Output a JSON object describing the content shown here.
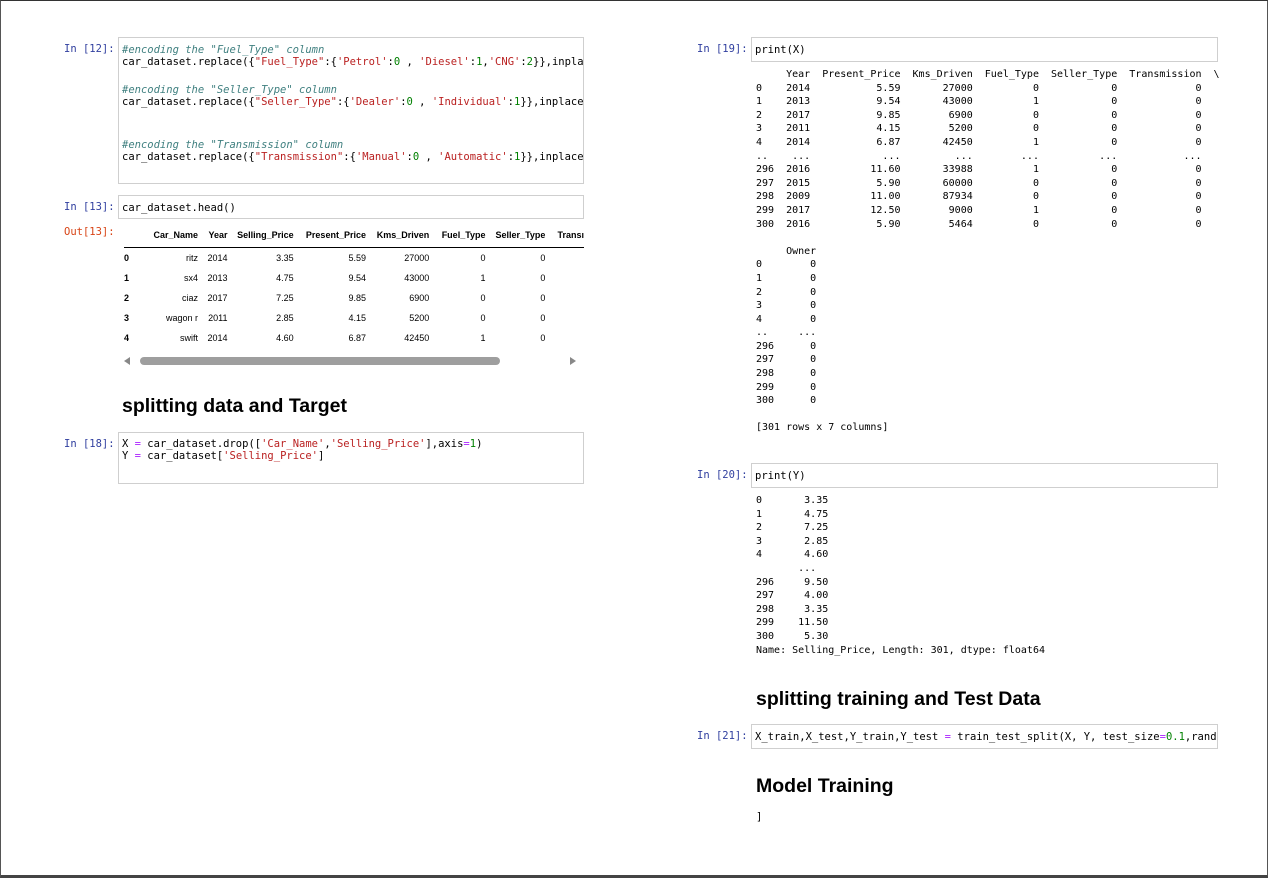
{
  "cells": {
    "c12": {
      "prompt": "In [12]:",
      "comment1": "#encoding the \"Fuel_Type\" column",
      "line1_a": "car_dataset.replace({",
      "line1_s1": "\"Fuel_Type\"",
      "line1_b": ":{",
      "line1_s2": "'Petrol'",
      "line1_c": ":",
      "line1_n1": "0",
      "line1_d": " , ",
      "line1_s3": "'Diesel'",
      "line1_e": ":",
      "line1_n2": "1",
      "line1_f": ",",
      "line1_s4": "'CNG'",
      "line1_g": ":",
      "line1_n3": "2",
      "line1_h": "}},inplace",
      "comment2": "#encoding the \"Seller_Type\" column",
      "line2_a": "car_dataset.replace({",
      "line2_s1": "\"Seller_Type\"",
      "line2_b": ":{",
      "line2_s2": "'Dealer'",
      "line2_c": ":",
      "line2_n1": "0",
      "line2_d": " , ",
      "line2_s3": "'Individual'",
      "line2_e": ":",
      "line2_n2": "1",
      "line2_f": "}},inplace=T",
      "comment3": "#encoding the \"Transmission\" column",
      "line3_a": "car_dataset.replace({",
      "line3_s1": "\"Transmission\"",
      "line3_b": ":{",
      "line3_s2": "'Manual'",
      "line3_c": ":",
      "line3_n1": "0",
      "line3_d": " , ",
      "line3_s3": "'Automatic'",
      "line3_e": ":",
      "line3_n2": "1",
      "line3_f": "}},inplace=T"
    },
    "c13": {
      "prompt": "In [13]:",
      "code": "car_dataset.head()",
      "out_prompt": "Out[13]:",
      "columns": [
        "Car_Name",
        "Year",
        "Selling_Price",
        "Present_Price",
        "Kms_Driven",
        "Fuel_Type",
        "Seller_Type",
        "Transı"
      ],
      "rows": [
        {
          "idx": "0",
          "cells": [
            "ritz",
            "2014",
            "3.35",
            "5.59",
            "27000",
            "0",
            "0"
          ]
        },
        {
          "idx": "1",
          "cells": [
            "sx4",
            "2013",
            "4.75",
            "9.54",
            "43000",
            "1",
            "0"
          ]
        },
        {
          "idx": "2",
          "cells": [
            "ciaz",
            "2017",
            "7.25",
            "9.85",
            "6900",
            "0",
            "0"
          ]
        },
        {
          "idx": "3",
          "cells": [
            "wagon r",
            "2011",
            "2.85",
            "4.15",
            "5200",
            "0",
            "0"
          ]
        },
        {
          "idx": "4",
          "cells": [
            "swift",
            "2014",
            "4.60",
            "6.87",
            "42450",
            "1",
            "0"
          ]
        }
      ]
    },
    "md1": "splitting data and Target",
    "c18": {
      "prompt": "In [18]:",
      "l1_a": "X ",
      "l1_op": "=",
      "l1_b": " car_dataset.drop([",
      "l1_s1": "'Car_Name'",
      "l1_c": ",",
      "l1_s2": "'Selling_Price'",
      "l1_d": "],axis",
      "l1_op2": "=",
      "l1_n": "1",
      "l1_e": ")",
      "l2_a": "Y ",
      "l2_op": "=",
      "l2_b": " car_dataset[",
      "l2_s": "'Selling_Price'",
      "l2_c": "]"
    },
    "c19": {
      "prompt": "In [19]:",
      "code": "print(X)",
      "output": "     Year  Present_Price  Kms_Driven  Fuel_Type  Seller_Type  Transmission  \\\n0    2014           5.59       27000          0            0             0   \n1    2013           9.54       43000          1            0             0   \n2    2017           9.85        6900          0            0             0   \n3    2011           4.15        5200          0            0             0   \n4    2014           6.87       42450          1            0             0   \n..    ...            ...         ...        ...          ...           ...   \n296  2016          11.60       33988          1            0             0   \n297  2015           5.90       60000          0            0             0   \n298  2009          11.00       87934          0            0             0   \n299  2017          12.50        9000          1            0             0   \n300  2016           5.90        5464          0            0             0   \n\n     Owner  \n0        0  \n1        0  \n2        0  \n3        0  \n4        0  \n..     ...  \n296      0  \n297      0  \n298      0  \n299      0  \n300      0  \n\n[301 rows x 7 columns]"
    },
    "c20": {
      "prompt": "In [20]:",
      "code": "print(Y)",
      "output": "0       3.35\n1       4.75\n2       7.25\n3       2.85\n4       4.60\n       ...  \n296     9.50\n297     4.00\n298     3.35\n299    11.50\n300     5.30\nName: Selling_Price, Length: 301, dtype: float64"
    },
    "md2": "splitting training and Test Data",
    "c21": {
      "prompt": "In [21]:",
      "a": "X_train,X_test,Y_train,Y_test ",
      "op": "=",
      "b": " train_test_split(X, Y, test_size",
      "op2": "=",
      "n": "0.1",
      "c": ",random"
    },
    "md3": "Model Training",
    "stray": "]"
  }
}
